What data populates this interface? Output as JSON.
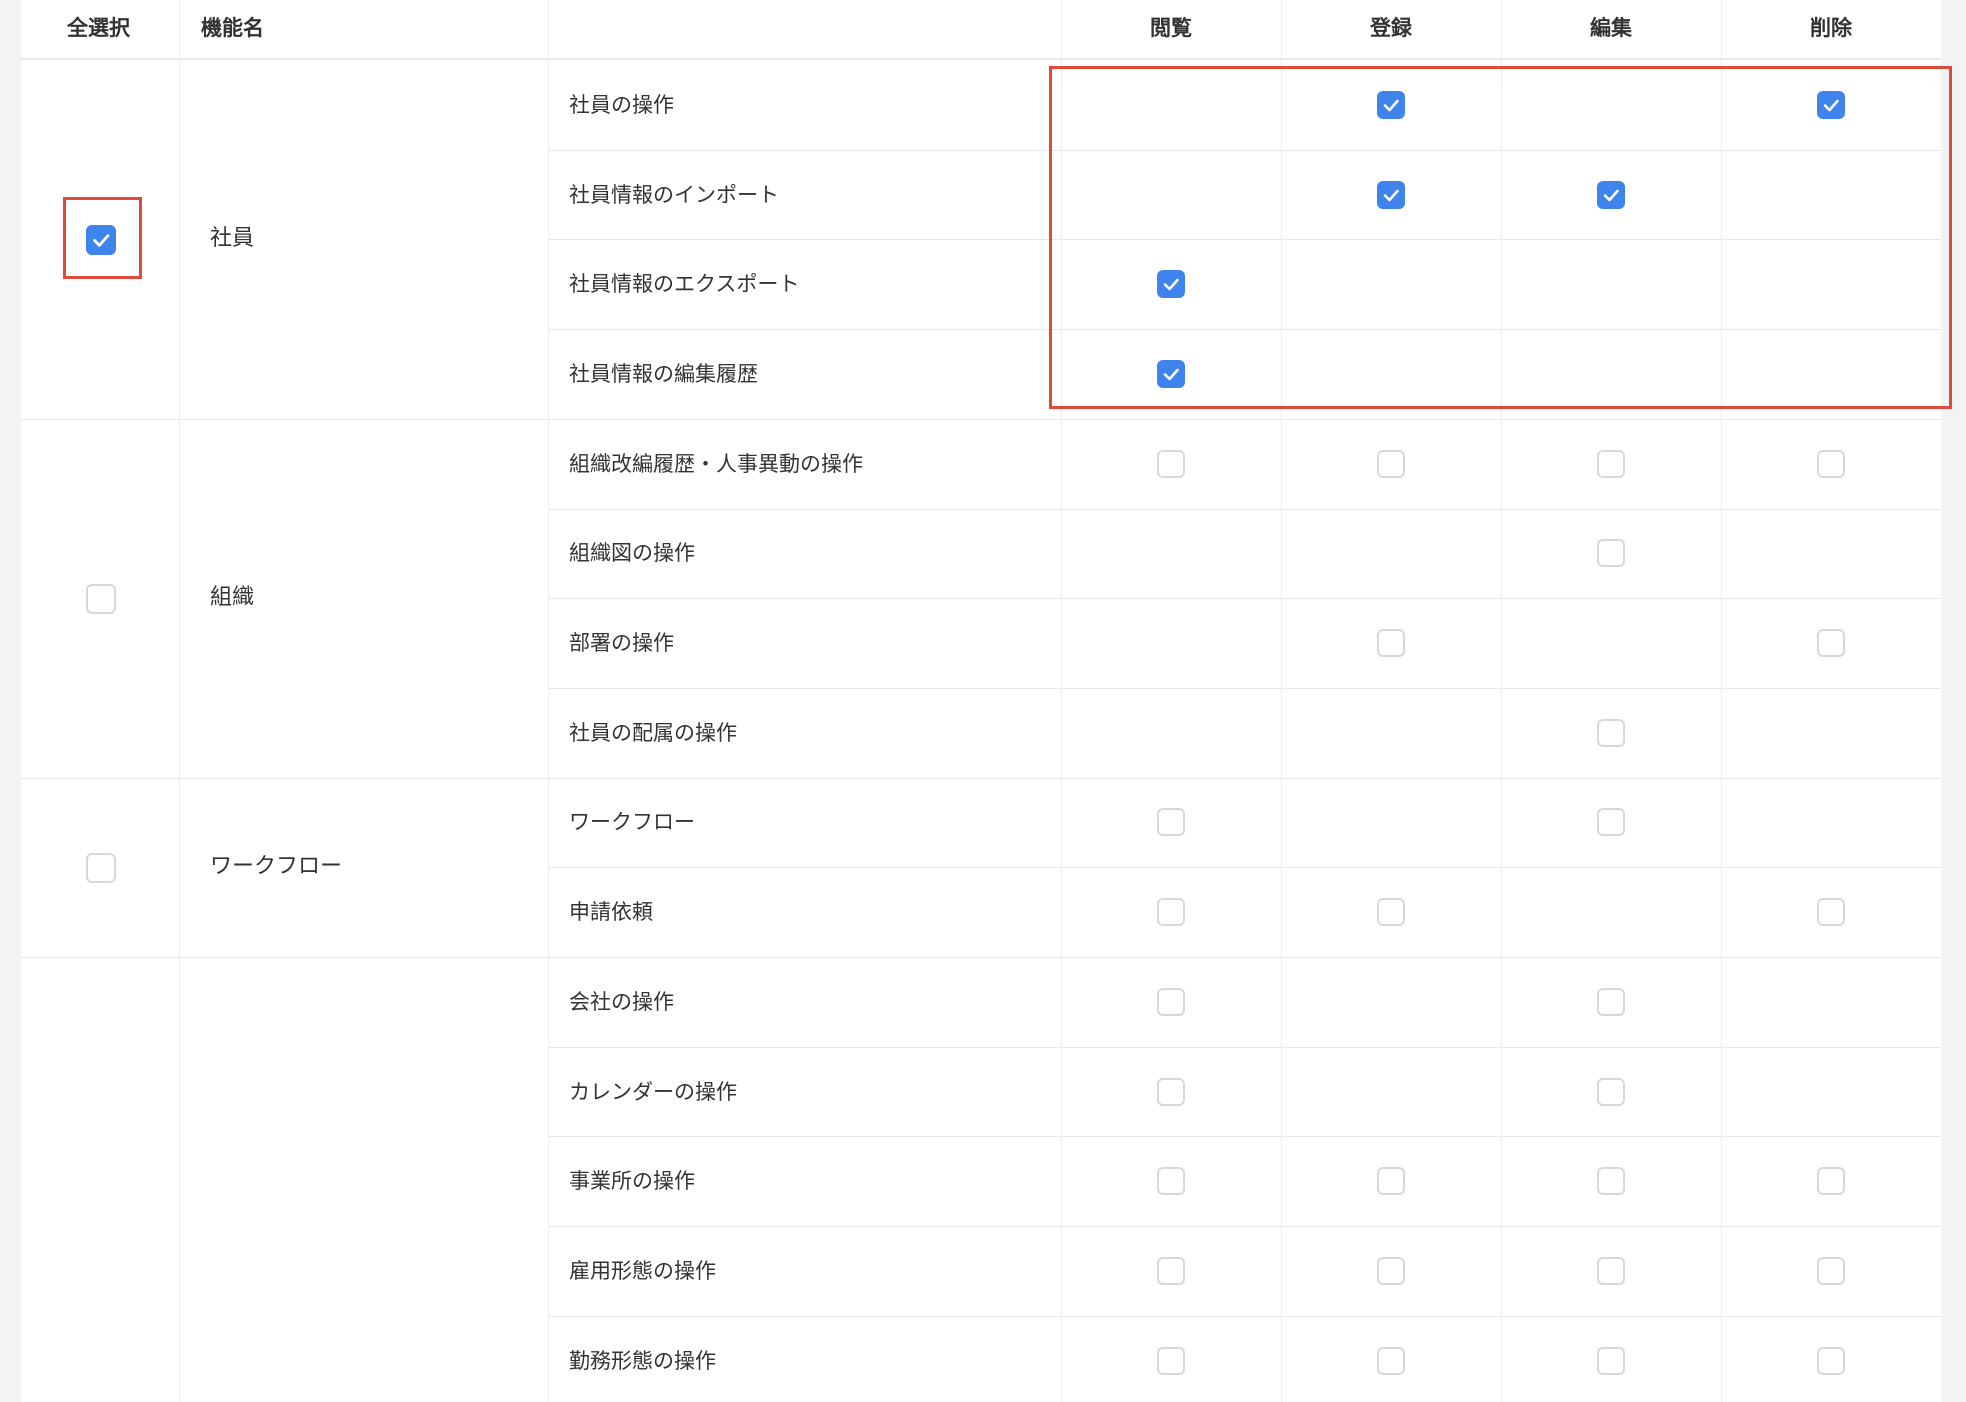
{
  "header": {
    "select_all": "全選択",
    "function_name": "機能名",
    "columns": [
      "閲覧",
      "登録",
      "編集",
      "削除"
    ]
  },
  "groups": [
    {
      "name": "社員",
      "checked": true,
      "rows": [
        {
          "label": "社員の操作",
          "cells": [
            null,
            true,
            null,
            true
          ]
        },
        {
          "label": "社員情報のインポート",
          "cells": [
            null,
            true,
            true,
            null
          ]
        },
        {
          "label": "社員情報のエクスポート",
          "cells": [
            true,
            null,
            null,
            null
          ]
        },
        {
          "label": "社員情報の編集履歴",
          "cells": [
            true,
            null,
            null,
            null
          ]
        }
      ]
    },
    {
      "name": "組織",
      "checked": false,
      "rows": [
        {
          "label": "組織改編履歴・人事異動の操作",
          "cells": [
            false,
            false,
            false,
            false
          ]
        },
        {
          "label": "組織図の操作",
          "cells": [
            null,
            null,
            false,
            null
          ]
        },
        {
          "label": "部署の操作",
          "cells": [
            null,
            false,
            null,
            false
          ]
        },
        {
          "label": "社員の配属の操作",
          "cells": [
            null,
            null,
            false,
            null
          ]
        }
      ]
    },
    {
      "name": "ワークフロー",
      "checked": false,
      "rows": [
        {
          "label": "ワークフロー",
          "cells": [
            false,
            null,
            false,
            null
          ]
        },
        {
          "label": "申請依頼",
          "cells": [
            false,
            false,
            null,
            false
          ]
        }
      ]
    },
    {
      "name": "",
      "checked": null,
      "rows": [
        {
          "label": "会社の操作",
          "cells": [
            false,
            null,
            false,
            null
          ]
        },
        {
          "label": "カレンダーの操作",
          "cells": [
            false,
            null,
            false,
            null
          ]
        },
        {
          "label": "事業所の操作",
          "cells": [
            false,
            false,
            false,
            false
          ]
        },
        {
          "label": "雇用形態の操作",
          "cells": [
            false,
            false,
            false,
            false
          ]
        },
        {
          "label": "勤務形態の操作",
          "cells": [
            false,
            false,
            false,
            false
          ]
        }
      ]
    }
  ],
  "colors": {
    "checkbox_checked": "#3f83ec",
    "checkbox_border": "#d5d8dd",
    "highlight": "#e04a3a"
  },
  "icons": {
    "checkmark": "check-icon"
  }
}
